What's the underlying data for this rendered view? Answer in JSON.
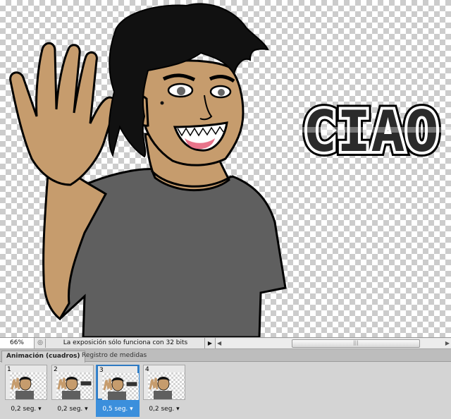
{
  "canvas": {
    "artwork_text": "CIAO"
  },
  "statusbar": {
    "zoom": "66%",
    "info": "La exposición sólo funciona con 32 bits",
    "icon": "navigator-icon"
  },
  "panel": {
    "tabs": [
      {
        "label": "Animación (cuadros)",
        "active": true
      },
      {
        "label": "Registro de medidas",
        "active": false
      }
    ],
    "frames": [
      {
        "number": "1",
        "delay": "0,2 seg.",
        "shows_text": false,
        "selected": false
      },
      {
        "number": "2",
        "delay": "0,2 seg.",
        "shows_text": true,
        "selected": false
      },
      {
        "number": "3",
        "delay": "0,5 seg.",
        "shows_text": true,
        "selected": true
      },
      {
        "number": "4",
        "delay": "0,2 seg.",
        "shows_text": false,
        "selected": false
      }
    ]
  },
  "colors": {
    "skin": "#c69c6d",
    "shirt": "#5f5f5f",
    "hair": "#111111",
    "selection": "#3b8fdc"
  }
}
